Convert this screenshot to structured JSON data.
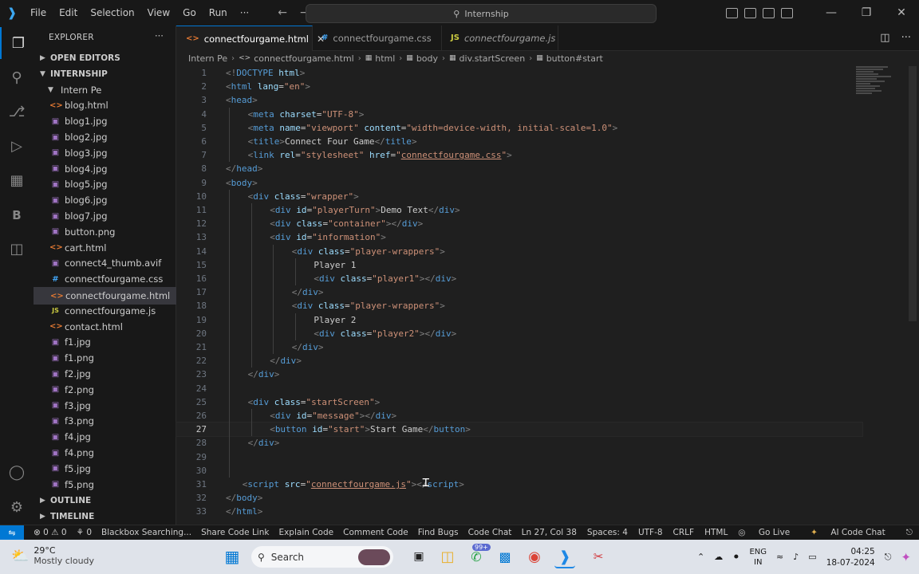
{
  "titlebar": {
    "menu": [
      "File",
      "Edit",
      "Selection",
      "View",
      "Go",
      "Run",
      "···"
    ],
    "search": "Internship"
  },
  "sidebar": {
    "title": "EXPLORER",
    "open_editors": "OPEN EDITORS",
    "workspace": "INTERNSHIP",
    "folder": "Intern Pe",
    "files": [
      {
        "name": "blog.html",
        "type": "html"
      },
      {
        "name": "blog1.jpg",
        "type": "img"
      },
      {
        "name": "blog2.jpg",
        "type": "img"
      },
      {
        "name": "blog3.jpg",
        "type": "img"
      },
      {
        "name": "blog4.jpg",
        "type": "img"
      },
      {
        "name": "blog5.jpg",
        "type": "img"
      },
      {
        "name": "blog6.jpg",
        "type": "img"
      },
      {
        "name": "blog7.jpg",
        "type": "img"
      },
      {
        "name": "button.png",
        "type": "img"
      },
      {
        "name": "cart.html",
        "type": "html"
      },
      {
        "name": "connect4_thumb.avif",
        "type": "avif"
      },
      {
        "name": "connectfourgame.css",
        "type": "css"
      },
      {
        "name": "connectfourgame.html",
        "type": "html",
        "selected": true
      },
      {
        "name": "connectfourgame.js",
        "type": "js"
      },
      {
        "name": "contact.html",
        "type": "html"
      },
      {
        "name": "f1.jpg",
        "type": "img"
      },
      {
        "name": "f1.png",
        "type": "img"
      },
      {
        "name": "f2.jpg",
        "type": "img"
      },
      {
        "name": "f2.png",
        "type": "img"
      },
      {
        "name": "f3.jpg",
        "type": "img"
      },
      {
        "name": "f3.png",
        "type": "img"
      },
      {
        "name": "f4.jpg",
        "type": "img"
      },
      {
        "name": "f4.png",
        "type": "img"
      },
      {
        "name": "f5.jpg",
        "type": "img"
      },
      {
        "name": "f5.png",
        "type": "img"
      }
    ],
    "outline": "OUTLINE",
    "timeline": "TIMELINE"
  },
  "tabs": [
    {
      "label": "connectfourgame.html",
      "type": "html",
      "active": true
    },
    {
      "label": "connectfourgame.css",
      "type": "css",
      "active": false
    },
    {
      "label": "connectfourgame.js",
      "type": "js",
      "active": false
    }
  ],
  "breadcrumb": [
    "Intern Pe",
    "connectfourgame.html",
    "html",
    "body",
    "div.startScreen",
    "button#start"
  ],
  "editor": {
    "current_line": 27,
    "lines": [
      {
        "n": "1",
        "indent": 0,
        "t": [
          [
            "b",
            "<!"
          ],
          [
            "tag",
            "DOCTYPE"
          ],
          [
            "txt",
            " "
          ],
          [
            "attr",
            "html"
          ],
          [
            "b",
            ">"
          ]
        ]
      },
      {
        "n": "2",
        "indent": 0,
        "t": [
          [
            "b",
            "<"
          ],
          [
            "tag",
            "html"
          ],
          [
            "txt",
            " "
          ],
          [
            "attr",
            "lang"
          ],
          [
            "txt",
            "="
          ],
          [
            "str",
            "\"en\""
          ],
          [
            "b",
            ">"
          ]
        ]
      },
      {
        "n": "3",
        "indent": 0,
        "t": [
          [
            "b",
            "<"
          ],
          [
            "tag",
            "head"
          ],
          [
            "b",
            ">"
          ]
        ]
      },
      {
        "n": "4",
        "indent": 1,
        "t": [
          [
            "b",
            "<"
          ],
          [
            "tag",
            "meta"
          ],
          [
            "txt",
            " "
          ],
          [
            "attr",
            "charset"
          ],
          [
            "txt",
            "="
          ],
          [
            "str",
            "\"UTF-8\""
          ],
          [
            "b",
            ">"
          ]
        ]
      },
      {
        "n": "5",
        "indent": 1,
        "t": [
          [
            "b",
            "<"
          ],
          [
            "tag",
            "meta"
          ],
          [
            "txt",
            " "
          ],
          [
            "attr",
            "name"
          ],
          [
            "txt",
            "="
          ],
          [
            "str",
            "\"viewport\""
          ],
          [
            "txt",
            " "
          ],
          [
            "attr",
            "content"
          ],
          [
            "txt",
            "="
          ],
          [
            "str",
            "\"width=device-width, initial-scale=1.0\""
          ],
          [
            "b",
            ">"
          ]
        ]
      },
      {
        "n": "6",
        "indent": 1,
        "t": [
          [
            "b",
            "<"
          ],
          [
            "tag",
            "title"
          ],
          [
            "b",
            ">"
          ],
          [
            "txt",
            "Connect Four Game"
          ],
          [
            "b",
            "</"
          ],
          [
            "tag",
            "title"
          ],
          [
            "b",
            ">"
          ]
        ]
      },
      {
        "n": "7",
        "indent": 1,
        "t": [
          [
            "b",
            "<"
          ],
          [
            "tag",
            "link"
          ],
          [
            "txt",
            " "
          ],
          [
            "attr",
            "rel"
          ],
          [
            "txt",
            "="
          ],
          [
            "str",
            "\"stylesheet\""
          ],
          [
            "txt",
            " "
          ],
          [
            "attr",
            "href"
          ],
          [
            "txt",
            "="
          ],
          [
            "str",
            "\""
          ],
          [
            "link",
            "connectfourgame.css"
          ],
          [
            "str",
            "\""
          ],
          [
            "b",
            ">"
          ]
        ]
      },
      {
        "n": "8",
        "indent": 0,
        "t": [
          [
            "b",
            "</"
          ],
          [
            "tag",
            "head"
          ],
          [
            "b",
            ">"
          ]
        ]
      },
      {
        "n": "9",
        "indent": 0,
        "t": [
          [
            "b",
            "<"
          ],
          [
            "tag",
            "body"
          ],
          [
            "b",
            ">"
          ]
        ]
      },
      {
        "n": "10",
        "indent": 1,
        "t": [
          [
            "b",
            "<"
          ],
          [
            "tag",
            "div"
          ],
          [
            "txt",
            " "
          ],
          [
            "attr",
            "class"
          ],
          [
            "txt",
            "="
          ],
          [
            "str",
            "\"wrapper\""
          ],
          [
            "b",
            ">"
          ]
        ]
      },
      {
        "n": "11",
        "indent": 2,
        "t": [
          [
            "b",
            "<"
          ],
          [
            "tag",
            "div"
          ],
          [
            "txt",
            " "
          ],
          [
            "attr",
            "id"
          ],
          [
            "txt",
            "="
          ],
          [
            "str",
            "\"playerTurn\""
          ],
          [
            "b",
            ">"
          ],
          [
            "txt",
            "Demo Text"
          ],
          [
            "b",
            "</"
          ],
          [
            "tag",
            "div"
          ],
          [
            "b",
            ">"
          ]
        ]
      },
      {
        "n": "12",
        "indent": 2,
        "t": [
          [
            "b",
            "<"
          ],
          [
            "tag",
            "div"
          ],
          [
            "txt",
            " "
          ],
          [
            "attr",
            "class"
          ],
          [
            "txt",
            "="
          ],
          [
            "str",
            "\"container\""
          ],
          [
            "b",
            "></"
          ],
          [
            "tag",
            "div"
          ],
          [
            "b",
            ">"
          ]
        ]
      },
      {
        "n": "13",
        "indent": 2,
        "t": [
          [
            "b",
            "<"
          ],
          [
            "tag",
            "div"
          ],
          [
            "txt",
            " "
          ],
          [
            "attr",
            "id"
          ],
          [
            "txt",
            "="
          ],
          [
            "str",
            "\"information\""
          ],
          [
            "b",
            ">"
          ]
        ]
      },
      {
        "n": "14",
        "indent": 3,
        "t": [
          [
            "b",
            "<"
          ],
          [
            "tag",
            "div"
          ],
          [
            "txt",
            " "
          ],
          [
            "attr",
            "class"
          ],
          [
            "txt",
            "="
          ],
          [
            "str",
            "\"player-wrappers\""
          ],
          [
            "b",
            ">"
          ]
        ]
      },
      {
        "n": "15",
        "indent": 4,
        "t": [
          [
            "txt",
            "Player 1"
          ]
        ]
      },
      {
        "n": "16",
        "indent": 4,
        "t": [
          [
            "b",
            "<"
          ],
          [
            "tag",
            "div"
          ],
          [
            "txt",
            " "
          ],
          [
            "attr",
            "class"
          ],
          [
            "txt",
            "="
          ],
          [
            "str",
            "\"player1\""
          ],
          [
            "b",
            "></"
          ],
          [
            "tag",
            "div"
          ],
          [
            "b",
            ">"
          ]
        ]
      },
      {
        "n": "17",
        "indent": 3,
        "t": [
          [
            "b",
            "</"
          ],
          [
            "tag",
            "div"
          ],
          [
            "b",
            ">"
          ]
        ]
      },
      {
        "n": "18",
        "indent": 3,
        "t": [
          [
            "b",
            "<"
          ],
          [
            "tag",
            "div"
          ],
          [
            "txt",
            " "
          ],
          [
            "attr",
            "class"
          ],
          [
            "txt",
            "="
          ],
          [
            "str",
            "\"player-wrappers\""
          ],
          [
            "b",
            ">"
          ]
        ]
      },
      {
        "n": "19",
        "indent": 4,
        "t": [
          [
            "txt",
            "Player 2"
          ]
        ]
      },
      {
        "n": "20",
        "indent": 4,
        "t": [
          [
            "b",
            "<"
          ],
          [
            "tag",
            "div"
          ],
          [
            "txt",
            " "
          ],
          [
            "attr",
            "class"
          ],
          [
            "txt",
            "="
          ],
          [
            "str",
            "\"player2\""
          ],
          [
            "b",
            "></"
          ],
          [
            "tag",
            "div"
          ],
          [
            "b",
            ">"
          ]
        ]
      },
      {
        "n": "21",
        "indent": 3,
        "t": [
          [
            "b",
            "</"
          ],
          [
            "tag",
            "div"
          ],
          [
            "b",
            ">"
          ]
        ]
      },
      {
        "n": "22",
        "indent": 2,
        "t": [
          [
            "b",
            "</"
          ],
          [
            "tag",
            "div"
          ],
          [
            "b",
            ">"
          ]
        ]
      },
      {
        "n": "23",
        "indent": 1,
        "t": [
          [
            "b",
            "</"
          ],
          [
            "tag",
            "div"
          ],
          [
            "b",
            ">"
          ]
        ]
      },
      {
        "n": "24",
        "indent": 0,
        "t": []
      },
      {
        "n": "25",
        "indent": 1,
        "t": [
          [
            "b",
            "<"
          ],
          [
            "tag",
            "div"
          ],
          [
            "txt",
            " "
          ],
          [
            "attr",
            "class"
          ],
          [
            "txt",
            "="
          ],
          [
            "str",
            "\"startScreen\""
          ],
          [
            "b",
            ">"
          ]
        ]
      },
      {
        "n": "26",
        "indent": 2,
        "t": [
          [
            "b",
            "<"
          ],
          [
            "tag",
            "div"
          ],
          [
            "txt",
            " "
          ],
          [
            "attr",
            "id"
          ],
          [
            "txt",
            "="
          ],
          [
            "str",
            "\"message\""
          ],
          [
            "b",
            "></"
          ],
          [
            "tag",
            "div"
          ],
          [
            "b",
            ">"
          ]
        ]
      },
      {
        "n": "27",
        "indent": 2,
        "t": [
          [
            "b",
            "<"
          ],
          [
            "tag",
            "button"
          ],
          [
            "txt",
            " "
          ],
          [
            "attr",
            "id"
          ],
          [
            "txt",
            "="
          ],
          [
            "str",
            "\"start\""
          ],
          [
            "b",
            ">"
          ],
          [
            "txt",
            "Start Game"
          ],
          [
            "b",
            "</"
          ],
          [
            "tag",
            "button"
          ],
          [
            "b",
            ">"
          ]
        ]
      },
      {
        "n": "28",
        "indent": 1,
        "t": [
          [
            "b",
            "</"
          ],
          [
            "tag",
            "div"
          ],
          [
            "b",
            ">"
          ]
        ]
      },
      {
        "n": "29",
        "indent": 0,
        "t": []
      },
      {
        "n": "30",
        "indent": 0,
        "t": []
      },
      {
        "n": "31",
        "indent": 0.75,
        "t": [
          [
            "b",
            "<"
          ],
          [
            "tag",
            "script"
          ],
          [
            "txt",
            " "
          ],
          [
            "attr",
            "src"
          ],
          [
            "txt",
            "="
          ],
          [
            "str",
            "\""
          ],
          [
            "link",
            "connectfourgame.js"
          ],
          [
            "str",
            "\""
          ],
          [
            "b",
            "></"
          ],
          [
            "tag",
            "script"
          ],
          [
            "b",
            ">"
          ]
        ]
      },
      {
        "n": "32",
        "indent": 0,
        "t": [
          [
            "b",
            "</"
          ],
          [
            "tag",
            "body"
          ],
          [
            "b",
            ">"
          ]
        ]
      },
      {
        "n": "33",
        "indent": 0,
        "t": [
          [
            "b",
            "</"
          ],
          [
            "tag",
            "html"
          ],
          [
            "b",
            ">"
          ]
        ]
      }
    ]
  },
  "statusbar": {
    "problems": "⊗ 0 ⚠ 0",
    "ports": "⚘ 0",
    "items": [
      "Blackbox Searching...",
      "Share Code Link",
      "Explain Code",
      "Comment Code",
      "Find Bugs",
      "Code Chat"
    ],
    "position": "Ln 27, Col 38",
    "spaces": "Spaces: 4",
    "encoding": "UTF-8",
    "eol": "CRLF",
    "language": "HTML",
    "golive": "Go Live",
    "aichat": "AI Code Chat"
  },
  "taskbar": {
    "temperature": "29°C",
    "weather": "Mostly cloudy",
    "search": "Search",
    "badge": "99+",
    "lang_top": "ENG",
    "lang_bottom": "IN",
    "time": "04:25",
    "date": "18-07-2024"
  },
  "colors": {
    "accent": "#0078d4",
    "editor_bg": "#1f1f1f",
    "tag": "#569cd6",
    "attr": "#9cdcfe",
    "string": "#ce9178"
  }
}
